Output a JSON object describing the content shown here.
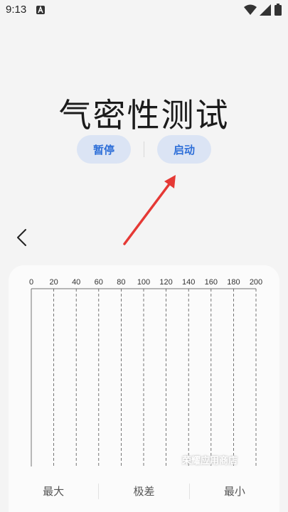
{
  "status_bar": {
    "time": "9:13",
    "notification_icon": "a-icon",
    "icons": [
      "wifi-icon",
      "cell-signal-icon",
      "battery-icon"
    ]
  },
  "page": {
    "title": "气密性测试",
    "pause_label": "暂停",
    "start_label": "启动",
    "annotation": "red-arrow-icon"
  },
  "chart_data": {
    "type": "line",
    "x_ticks": [
      0,
      20,
      40,
      60,
      80,
      100,
      120,
      140,
      160,
      180,
      200
    ],
    "xlim": [
      0,
      200
    ],
    "grid": "dashed vertical",
    "series": []
  },
  "watermark": "荣耀应用商店",
  "stats": {
    "max_label": "最大",
    "range_label": "极差",
    "min_label": "最小"
  },
  "colors": {
    "accent": "#2e6fd8",
    "pill_bg": "#dbe4f4",
    "arrow": "#e53935"
  }
}
